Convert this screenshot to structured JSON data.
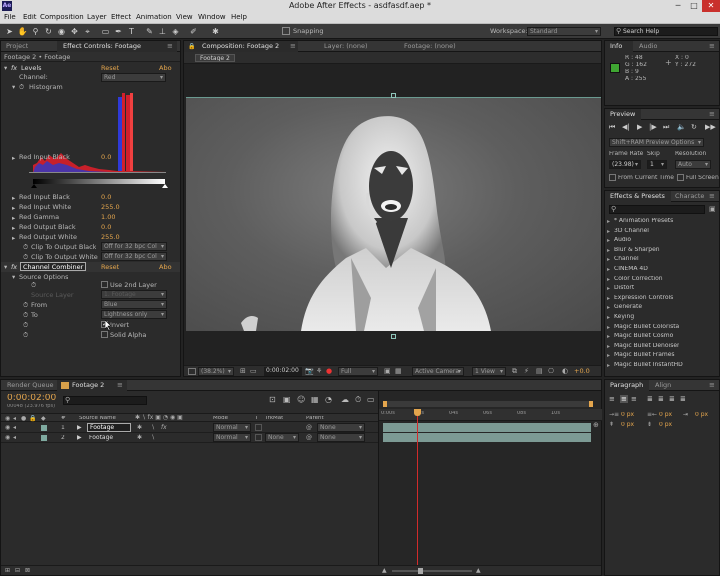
{
  "window": {
    "app_icon": "Ae",
    "title": "Adobe After Effects - asdfasdf.aep *",
    "minimize": "─",
    "maximize": "□",
    "close": "✕"
  },
  "menu": [
    "File",
    "Edit",
    "Composition",
    "Layer",
    "Effect",
    "Animation",
    "View",
    "Window",
    "Help"
  ],
  "toolbar": {
    "snapping_label": "Snapping",
    "workspace_label": "Workspace:",
    "workspace_value": "Standard",
    "search_help": "Search Help"
  },
  "left_panel": {
    "tab_project": "Project",
    "tab_effect_controls": "Effect Controls: Footage",
    "breadcrumb": "Footage 2 • Footage",
    "levels": {
      "name": "Levels",
      "reset": "Reset",
      "about": "Abo",
      "channel_label": "Channel:",
      "channel_value": "Red",
      "histogram_label": "Histogram",
      "params": [
        {
          "label": "Red Input Black",
          "value": "0.0"
        },
        {
          "label": "Red Input White",
          "value": "255.0"
        },
        {
          "label": "Red Gamma",
          "value": "1.00"
        },
        {
          "label": "Red Output Black",
          "value": "0.0"
        },
        {
          "label": "Red Output White",
          "value": "255.0"
        }
      ],
      "clip_black_label": "Clip To Output Black",
      "clip_black_value": "Off for 32 bpc Col",
      "clip_white_label": "Clip To Output White",
      "clip_white_value": "Off for 32 bpc Col"
    },
    "channel_combiner": {
      "name": "Channel Combiner",
      "reset": "Reset",
      "about": "Abo",
      "source_options": "Source Options",
      "use_2nd_layer": "Use 2nd Layer",
      "source_layer_label": "Source Layer",
      "source_layer_value": "1. Footage",
      "from_label": "From",
      "from_value": "Blue",
      "to_label": "To",
      "to_value": "Lightness only",
      "invert": "Invert",
      "solid_alpha": "Solid Alpha"
    }
  },
  "viewer": {
    "tab_composition": "Composition: Footage 2",
    "tab_layer": "Layer: (none)",
    "tab_footage": "Footage: (none)",
    "comp_button": "Footage 2",
    "zoom": "(38.2%)",
    "timecode": "0:00:02:00",
    "resolution": "Full",
    "camera": "Active Camera",
    "view": "1 View",
    "exposure": "+0.0"
  },
  "info": {
    "tab_info": "Info",
    "tab_audio": "Audio",
    "r": "R : 48",
    "g": "G : 162",
    "b": "B : 9",
    "a": "A : 255",
    "x": "X : 0",
    "y": "Y : 272",
    "swatch_color": "#3fa632"
  },
  "preview": {
    "tab": "Preview",
    "mode": "Shift+RAM Preview Options",
    "frame_rate_label": "Frame Rate",
    "skip_label": "Skip",
    "resolution_label": "Resolution",
    "frame_rate_value": "(23.98)",
    "skip_value": "1",
    "resolution_value": "Auto",
    "from_current": "From Current Time",
    "full_screen": "Full Screen"
  },
  "effects_presets": {
    "tab": "Effects & Presets",
    "tab2": "Characte",
    "search_placeholder": "",
    "items": [
      "* Animation Presets",
      "3D Channel",
      "Audio",
      "Blur & Sharpen",
      "Channel",
      "CINEMA 4D",
      "Color Correction",
      "Distort",
      "Expression Controls",
      "Generate",
      "Keying",
      "Magic Bullet Colorista",
      "Magic Bullet Cosmo",
      "Magic Bullet Denoiser",
      "Magic Bullet Frames",
      "Magic Bullet InstantHD"
    ]
  },
  "paragraph": {
    "tab": "Paragraph",
    "tab2": "Align",
    "fields": [
      "0 px",
      "0 px",
      "0 px",
      "0 px",
      "0 px"
    ]
  },
  "timeline": {
    "tab_render_queue": "Render Queue",
    "tab_footage2": "Footage 2",
    "timecode": "0:00:02:00",
    "frames": "00048 (23.976 fps)",
    "columns": {
      "hash": "#",
      "source_name": "Source Name",
      "mode": "Mode",
      "t": "T",
      "trkmat": "TrkMat",
      "parent": "Parent"
    },
    "layers": [
      {
        "num": "1",
        "name": "Footage",
        "mode": "Normal",
        "trkmat": "",
        "parent": "None"
      },
      {
        "num": "2",
        "name": "Footage",
        "mode": "Normal",
        "trkmat": "None",
        "parent": "None"
      }
    ],
    "ruler": [
      "0:00s",
      "02s",
      "04s",
      "06s",
      "08s",
      "10s"
    ]
  }
}
